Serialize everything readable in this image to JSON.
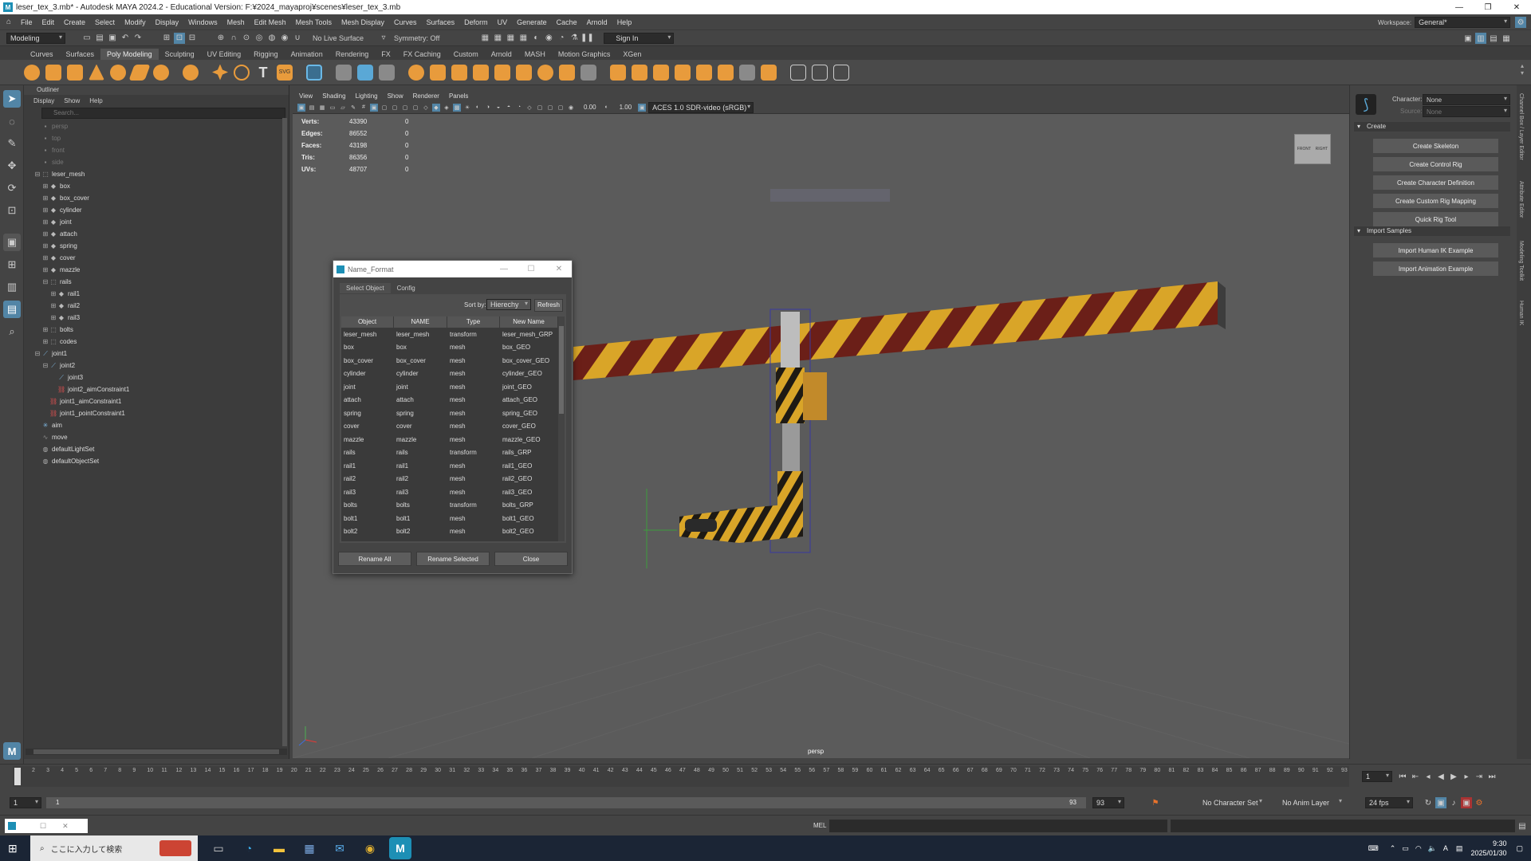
{
  "window": {
    "title": "leser_tex_3.mb* - Autodesk MAYA 2024.2 - Educational Version: F:¥2024_mayaproj¥scenes¥leser_tex_3.mb",
    "workspace_label": "Workspace:",
    "workspace_value": "General*"
  },
  "menubar": [
    "File",
    "Edit",
    "Create",
    "Select",
    "Modify",
    "Display",
    "Windows",
    "Mesh",
    "Edit Mesh",
    "Mesh Tools",
    "Mesh Display",
    "Curves",
    "Surfaces",
    "Deform",
    "UV",
    "Generate",
    "Cache",
    "Arnold",
    "Help"
  ],
  "statusline": {
    "mode": "Modeling",
    "live_surface": "No Live Surface",
    "symmetry": "Symmetry: Off",
    "sign_in": "Sign In"
  },
  "shelf_tabs": [
    "Curves",
    "Surfaces",
    "Poly Modeling",
    "Sculpting",
    "UV Editing",
    "Rigging",
    "Animation",
    "Rendering",
    "FX",
    "FX Caching",
    "Custom",
    "Arnold",
    "MASH",
    "Motion Graphics",
    "XGen"
  ],
  "shelf_active_tab": "Poly Modeling",
  "outliner": {
    "title": "Outliner",
    "menu": [
      "Display",
      "Show",
      "Help"
    ],
    "search_placeholder": "Search...",
    "items": [
      {
        "label": "persp",
        "depth": 0,
        "icon": "camera",
        "dim": true
      },
      {
        "label": "top",
        "depth": 0,
        "icon": "camera",
        "dim": true
      },
      {
        "label": "front",
        "depth": 0,
        "icon": "camera",
        "dim": true
      },
      {
        "label": "side",
        "depth": 0,
        "icon": "camera",
        "dim": true
      },
      {
        "label": "leser_mesh",
        "depth": 0,
        "icon": "group",
        "expand": "-"
      },
      {
        "label": "box",
        "depth": 1,
        "icon": "mesh",
        "expand": "+"
      },
      {
        "label": "box_cover",
        "depth": 1,
        "icon": "mesh",
        "expand": "+"
      },
      {
        "label": "cylinder",
        "depth": 1,
        "icon": "mesh",
        "expand": "+"
      },
      {
        "label": "joint",
        "depth": 1,
        "icon": "mesh",
        "expand": "+"
      },
      {
        "label": "attach",
        "depth": 1,
        "icon": "mesh",
        "expand": "+"
      },
      {
        "label": "spring",
        "depth": 1,
        "icon": "mesh",
        "expand": "+"
      },
      {
        "label": "cover",
        "depth": 1,
        "icon": "mesh",
        "expand": "+"
      },
      {
        "label": "mazzle",
        "depth": 1,
        "icon": "mesh",
        "expand": "+"
      },
      {
        "label": "rails",
        "depth": 1,
        "icon": "group",
        "expand": "-"
      },
      {
        "label": "rail1",
        "depth": 2,
        "icon": "mesh",
        "expand": "+"
      },
      {
        "label": "rail2",
        "depth": 2,
        "icon": "mesh",
        "expand": "+"
      },
      {
        "label": "rail3",
        "depth": 2,
        "icon": "mesh",
        "expand": "+"
      },
      {
        "label": "bolts",
        "depth": 1,
        "icon": "group",
        "expand": "+"
      },
      {
        "label": "codes",
        "depth": 1,
        "icon": "group",
        "expand": "+"
      },
      {
        "label": "joint1",
        "depth": 0,
        "icon": "joint",
        "expand": "-"
      },
      {
        "label": "joint2",
        "depth": 1,
        "icon": "joint",
        "expand": "-"
      },
      {
        "label": "joint3",
        "depth": 2,
        "icon": "joint"
      },
      {
        "label": "joint2_aimConstraint1",
        "depth": 2,
        "icon": "constraint"
      },
      {
        "label": "joint1_aimConstraint1",
        "depth": 1,
        "icon": "constraint"
      },
      {
        "label": "joint1_pointConstraint1",
        "depth": 1,
        "icon": "constraint"
      },
      {
        "label": "aim",
        "depth": 0,
        "icon": "locator"
      },
      {
        "label": "move",
        "depth": 0,
        "icon": "curve"
      },
      {
        "label": "defaultLightSet",
        "depth": 0,
        "icon": "set"
      },
      {
        "label": "defaultObjectSet",
        "depth": 0,
        "icon": "set"
      }
    ]
  },
  "viewport": {
    "menu": [
      "View",
      "Shading",
      "Lighting",
      "Show",
      "Renderer",
      "Panels"
    ],
    "value_a": "0.00",
    "value_b": "1.00",
    "colorspace": "ACES 1.0 SDR-video (sRGB)",
    "hud": [
      {
        "label": "Verts:",
        "v1": "43390",
        "v2": "0"
      },
      {
        "label": "Edges:",
        "v1": "86552",
        "v2": "0"
      },
      {
        "label": "Faces:",
        "v1": "43198",
        "v2": "0"
      },
      {
        "label": "Tris:",
        "v1": "86356",
        "v2": "0"
      },
      {
        "label": "UVs:",
        "v1": "48707",
        "v2": "0"
      }
    ],
    "camera_label": "persp",
    "viewcube_front": "FRONT",
    "viewcube_right": "RIGHT"
  },
  "dialog": {
    "title": "Name_Format",
    "tabs": [
      "Select Object",
      "Config"
    ],
    "sort_label": "Sort by:",
    "sort_value": "Hierechy",
    "refresh": "Refresh",
    "columns": [
      "Object",
      "NAME",
      "Type",
      "New Name"
    ],
    "rows": [
      [
        "leser_mesh",
        "leser_mesh",
        "transform",
        "leser_mesh_GRP"
      ],
      [
        "box",
        "box",
        "mesh",
        "box_GEO"
      ],
      [
        "box_cover",
        "box_cover",
        "mesh",
        "box_cover_GEO"
      ],
      [
        "cylinder",
        "cylinder",
        "mesh",
        "cylinder_GEO"
      ],
      [
        "joint",
        "joint",
        "mesh",
        "joint_GEO"
      ],
      [
        "attach",
        "attach",
        "mesh",
        "attach_GEO"
      ],
      [
        "spring",
        "spring",
        "mesh",
        "spring_GEO"
      ],
      [
        "cover",
        "cover",
        "mesh",
        "cover_GEO"
      ],
      [
        "mazzle",
        "mazzle",
        "mesh",
        "mazzle_GEO"
      ],
      [
        "rails",
        "rails",
        "transform",
        "rails_GRP"
      ],
      [
        "rail1",
        "rail1",
        "mesh",
        "rail1_GEO"
      ],
      [
        "rail2",
        "rail2",
        "mesh",
        "rail2_GEO"
      ],
      [
        "rail3",
        "rail3",
        "mesh",
        "rail3_GEO"
      ],
      [
        "bolts",
        "bolts",
        "transform",
        "bolts_GRP"
      ],
      [
        "bolt1",
        "bolt1",
        "mesh",
        "bolt1_GEO"
      ],
      [
        "bolt2",
        "bolt2",
        "mesh",
        "bolt2_GEO"
      ]
    ],
    "btn_rename_all": "Rename All",
    "btn_rename_selected": "Rename Selected",
    "btn_close": "Close"
  },
  "right_panel": {
    "character_label": "Character:",
    "character_value": "None",
    "source_label": "Source:",
    "source_value": "None",
    "create_header": "Create",
    "create_buttons": [
      "Create Skeleton",
      "Create Control Rig",
      "Create Character Definition",
      "Create Custom Rig Mapping",
      "Quick Rig Tool"
    ],
    "import_header": "Import Samples",
    "import_buttons": [
      "Import Human IK Example",
      "Import Animation Example"
    ],
    "side_tabs": [
      "Channel Box / Layer Editor",
      "Attribute Editor",
      "Modeling Toolkit",
      "Human IK"
    ]
  },
  "timeline": {
    "ticks": [
      "1",
      "2",
      "3",
      "4",
      "5",
      "6",
      "7",
      "8",
      "9",
      "10",
      "11",
      "12",
      "13",
      "14",
      "15",
      "16",
      "17",
      "18",
      "19",
      "20",
      "21",
      "22",
      "23",
      "24",
      "25",
      "26",
      "27",
      "28",
      "29",
      "30",
      "31",
      "32",
      "33",
      "34",
      "35",
      "36",
      "37",
      "38",
      "39",
      "40",
      "41",
      "42",
      "43",
      "44",
      "45",
      "46",
      "47",
      "48",
      "49",
      "50",
      "51",
      "52",
      "53",
      "54",
      "55",
      "56",
      "57",
      "58",
      "59",
      "60",
      "61",
      "62",
      "63",
      "64",
      "65",
      "66",
      "67",
      "68",
      "69",
      "70",
      "71",
      "72",
      "73",
      "74",
      "75",
      "76",
      "77",
      "78",
      "79",
      "80",
      "81",
      "82",
      "83",
      "84",
      "85",
      "86",
      "87",
      "88",
      "89",
      "90",
      "91",
      "92",
      "93"
    ],
    "current_frame": "1",
    "range_start": "1",
    "range_inner_start": "1",
    "range_inner_end": "93",
    "range_end": "93",
    "character_set": "No Character Set",
    "anim_layer": "No Anim Layer",
    "fps": "24 fps"
  },
  "cmdline": {
    "mel_label": "MEL"
  },
  "taskbar": {
    "search_placeholder": "ここに入力して検索",
    "time": "9:30",
    "date": "2025/01/30",
    "ime": "A"
  }
}
